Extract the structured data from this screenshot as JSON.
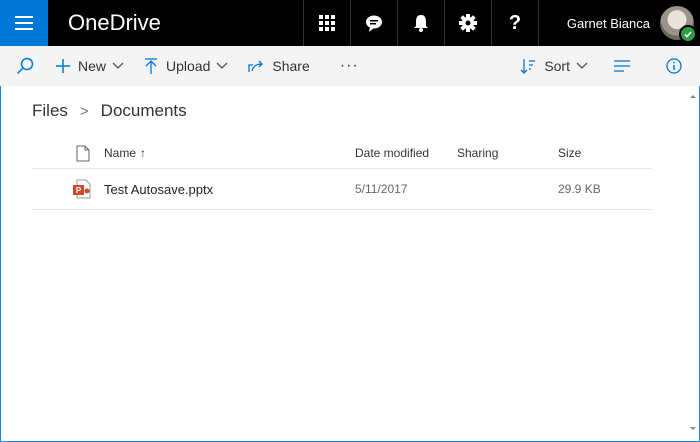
{
  "app": {
    "title": "OneDrive"
  },
  "user": {
    "name": "Garnet Bianca"
  },
  "header_icons": [
    "app-launcher-icon",
    "chat-icon",
    "bell-icon",
    "gear-icon",
    "help-icon"
  ],
  "header": {
    "help_label": "?"
  },
  "toolbar": {
    "new_label": "New",
    "upload_label": "Upload",
    "share_label": "Share",
    "more_label": "···",
    "sort_label": "Sort"
  },
  "breadcrumb": {
    "root": "Files",
    "separator": ">",
    "current": "Documents"
  },
  "table": {
    "headers": {
      "name": "Name",
      "name_sort": "↑",
      "modified": "Date modified",
      "sharing": "Sharing",
      "size": "Size"
    },
    "rows": [
      {
        "name": "Test Autosave.pptx",
        "modified": "5/11/2017",
        "sharing": "",
        "size": "29.9 KB",
        "icon": "powerpoint-file-icon"
      }
    ]
  },
  "colors": {
    "accent": "#0078d7",
    "topbar": "#000000",
    "commandbar": "#f4f4f4",
    "powerpoint": "#d24726",
    "presence": "#2e9e45"
  }
}
